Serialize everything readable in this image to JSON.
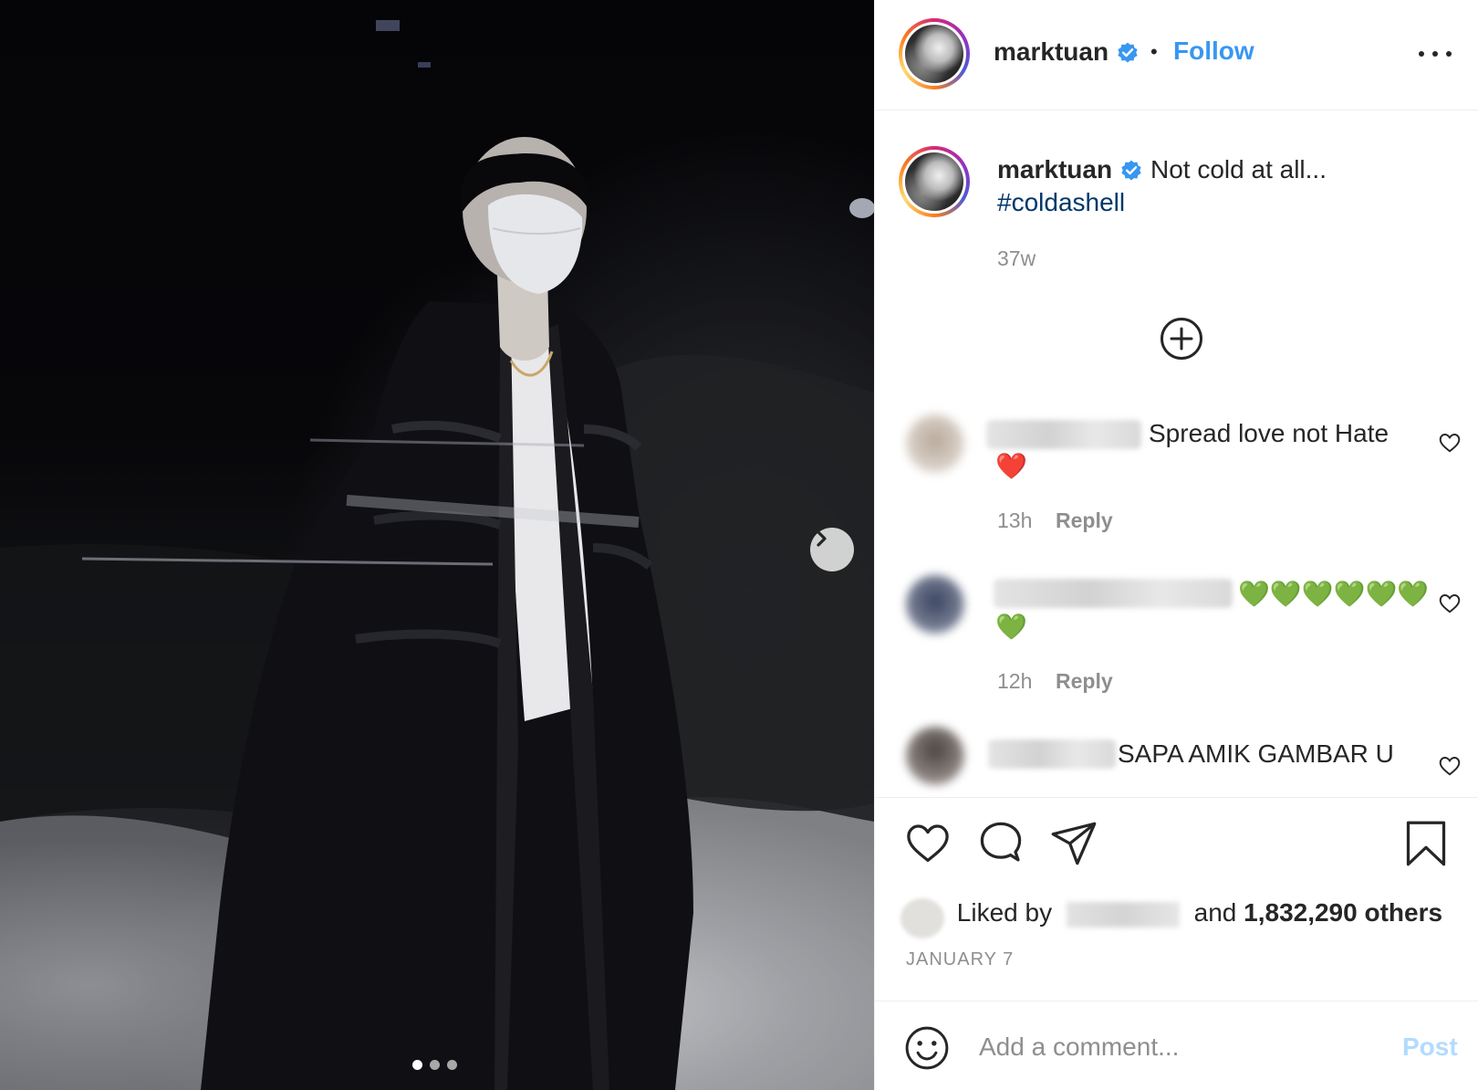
{
  "post": {
    "username": "marktuan",
    "follow_label": "Follow",
    "separator": "•",
    "caption": "Not cold at all...",
    "hashtag": "#coldashell",
    "caption_age": "37w",
    "slides_count": 3,
    "active_slide": 1
  },
  "comments": [
    {
      "text": "Spread love not Hate",
      "emoji": "❤️",
      "time": "13h",
      "reply_label": "Reply"
    },
    {
      "text": "💚💚💚💚💚💚",
      "emoji": "💚",
      "time": "12h",
      "reply_label": "Reply"
    },
    {
      "text": "SAPA AMIK GAMBAR U"
    }
  ],
  "likes": {
    "prefix": "Liked by",
    "suffix_and": "and",
    "count_text": "1,832,290 others"
  },
  "date": "JANUARY 7",
  "add_comment": {
    "placeholder": "Add a comment...",
    "post_label": "Post"
  },
  "colors": {
    "link_blue": "#3897f0",
    "hashtag_blue": "#00376b",
    "verified_blue": "#3897f0",
    "post_disabled": "#b3dbff",
    "text_primary": "#262626",
    "text_secondary": "#8e8e8e"
  },
  "icons": {
    "verified": "verified-badge-icon",
    "more": "more-options-icon",
    "load_more": "plus-circle-icon",
    "like": "heart-icon",
    "comment": "comment-bubble-icon",
    "share": "paper-plane-icon",
    "save": "bookmark-icon",
    "emoji": "smiley-icon",
    "next": "chevron-right-icon"
  }
}
